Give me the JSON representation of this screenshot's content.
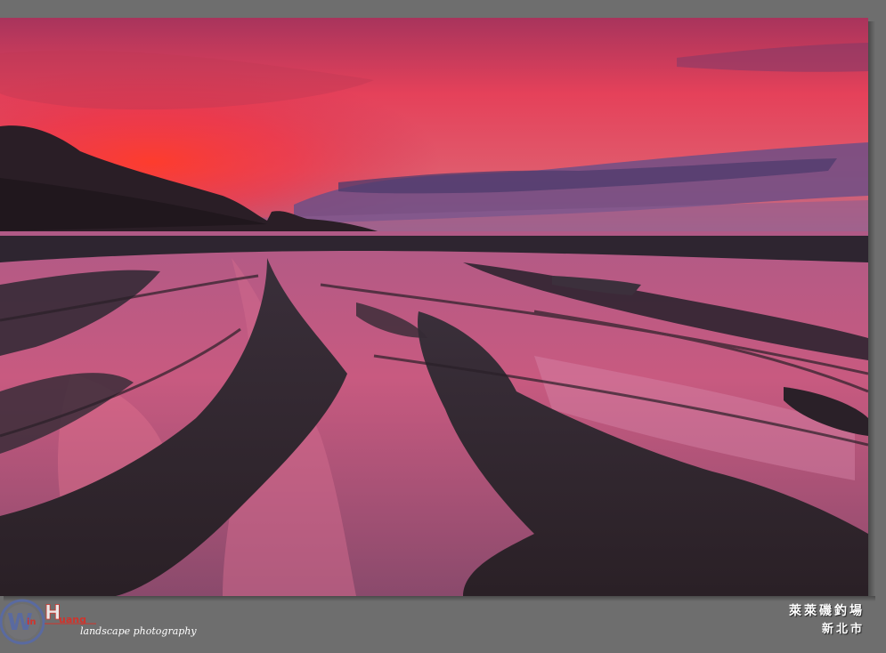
{
  "watermark": {
    "initials_w": "W",
    "initials_in": "in",
    "initials_h": "H",
    "initials_uang": "uang",
    "tagline": "landscape photography"
  },
  "caption": {
    "place": "萊萊磯釣場",
    "city": "新北市"
  },
  "colors": {
    "sky_top": "#b8325a",
    "sky_glow": "#ff3a36",
    "horizon": "#7a5a90",
    "logo_red": "#d0342c",
    "logo_blue": "#5a6aa0",
    "background": "#6e6e6e"
  }
}
